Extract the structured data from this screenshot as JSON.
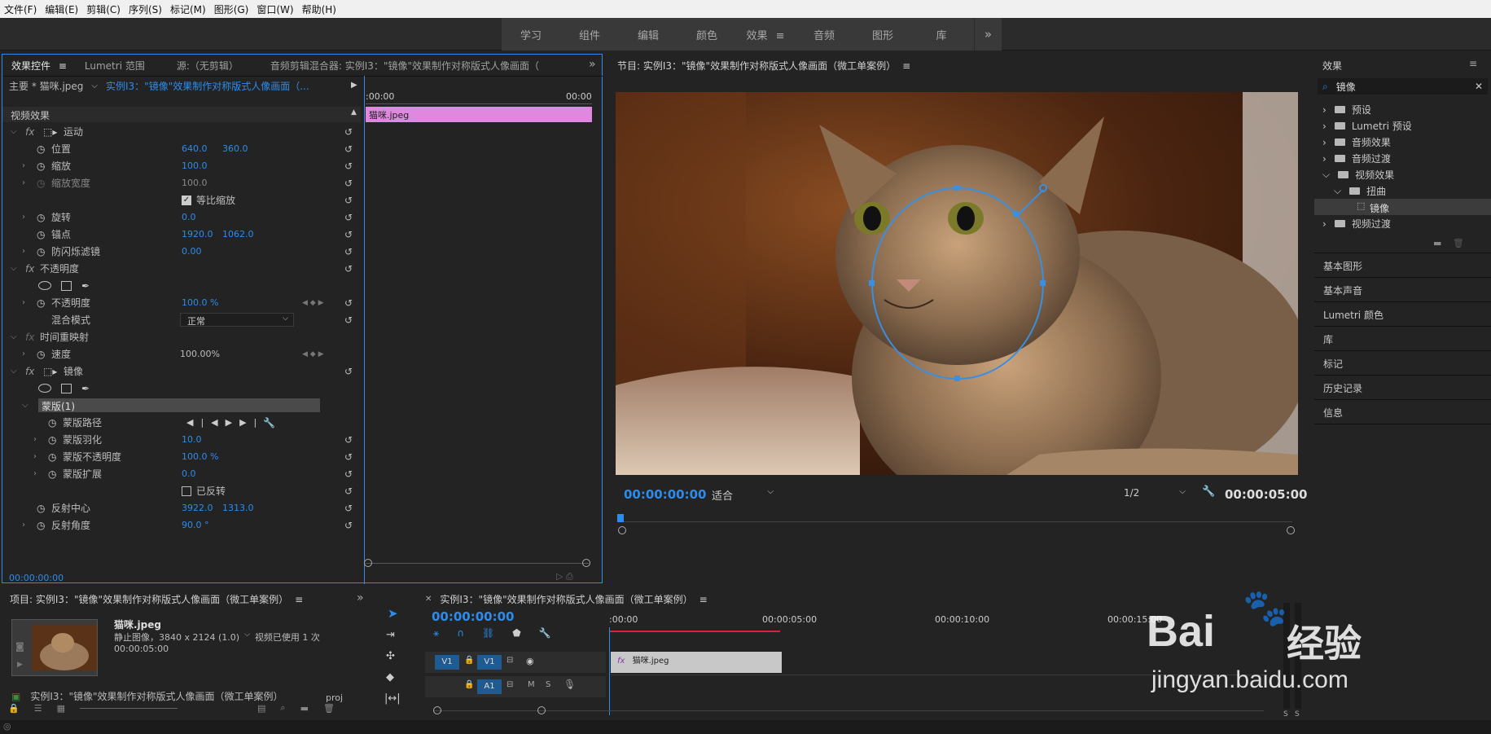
{
  "menu": [
    "文件(F)",
    "编辑(E)",
    "剪辑(C)",
    "序列(S)",
    "标记(M)",
    "图形(G)",
    "窗口(W)",
    "帮助(H)"
  ],
  "workspace_tabs": [
    "学习",
    "组件",
    "编辑",
    "颜色",
    "效果",
    "音频",
    "图形",
    "库"
  ],
  "workspace_active": "效果",
  "effect_controls": {
    "tabs": [
      "效果控件",
      "Lumetri 范围",
      "源:（无剪辑）",
      "音频剪辑混合器: 实例I3：\"镜像\"效果制作对称版式人像画面（"
    ],
    "clip_main": "主要 * 猫咪.jpeg",
    "clip_seq": "实例I3：\"镜像\"效果制作对称版式人像画面（...",
    "tl_start": ":00:00",
    "tl_end": "00:00",
    "clip_name": "猫咪.jpeg",
    "section_video": "视频效果",
    "motion": "运动",
    "position": "位置",
    "position_x": "640.0",
    "position_y": "360.0",
    "scale": "缩放",
    "scale_v": "100.0",
    "scale_width": "缩放宽度",
    "scale_width_v": "100.0",
    "uniform_scale": "等比缩放",
    "rotation": "旋转",
    "rotation_v": "0.0",
    "anchor": "锚点",
    "anchor_x": "1920.0",
    "anchor_y": "1062.0",
    "antiflicker": "防闪烁滤镜",
    "antiflicker_v": "0.00",
    "opacity_fx": "不透明度",
    "opacity": "不透明度",
    "opacity_v": "100.0 %",
    "blend_mode": "混合模式",
    "blend_mode_v": "正常",
    "time_remap": "时间重映射",
    "speed": "速度",
    "speed_v": "100.00%",
    "mirror": "镜像",
    "mask": "蒙版(1)",
    "mask_path": "蒙版路径",
    "mask_feather": "蒙版羽化",
    "mask_feather_v": "10.0",
    "mask_opacity": "蒙版不透明度",
    "mask_opacity_v": "100.0 %",
    "mask_expand": "蒙版扩展",
    "mask_expand_v": "0.0",
    "inverted": "已反转",
    "reflect_center": "反射中心",
    "reflect_center_x": "3922.0",
    "reflect_center_y": "1313.0",
    "reflect_angle": "反射角度",
    "reflect_angle_v": "90.0 °",
    "timecode": "00:00:00:00"
  },
  "program": {
    "title": "节目: 实例I3：\"镜像\"效果制作对称版式人像画面（微工单案例）",
    "timecode": "00:00:00:00",
    "fit": "适合",
    "quality": "1/2",
    "duration": "00:00:05:00"
  },
  "effects_panel": {
    "title": "效果",
    "search": "镜像",
    "folders": [
      "预设",
      "Lumetri 预设",
      "音频效果",
      "音频过渡",
      "视频效果",
      "扭曲",
      "镜像",
      "视频过渡"
    ],
    "panels": [
      "基本图形",
      "基本声音",
      "Lumetri 颜色",
      "库",
      "标记",
      "历史记录",
      "信息"
    ]
  },
  "project": {
    "title": "项目: 实例I3：\"镜像\"效果制作对称版式人像画面（微工单案例）",
    "file_name": "猫咪.jpeg",
    "file_info": "静止图像，3840 x 2124 (1.0)",
    "file_used": "视频已使用 1 次",
    "file_duration": "00:00:05:00",
    "bottom_item": "实例I3：\"镜像\"效果制作对称版式人像画面（微工单案例）",
    "bottom_ext": "proj"
  },
  "timeline": {
    "title": "实例I3：\"镜像\"效果制作对称版式人像画面（微工单案例）",
    "timecode": "00:00:00:00",
    "ruler": [
      ":00:00",
      "00:00:05:00",
      "00:00:10:00",
      "00:00:15:00"
    ],
    "v1": "V1",
    "a1": "A1",
    "m": "M",
    "s": "S",
    "clip": "猫咪.jpeg"
  },
  "meter": {
    "s_left": "S",
    "s_right": "S"
  },
  "watermark": {
    "brand": "Bai",
    "cn": "经验",
    "url": "jingyan.baidu.com"
  },
  "colors": {
    "accent": "#2d8ceb",
    "clip_pink": "#e088e0",
    "panel": "#232323"
  }
}
